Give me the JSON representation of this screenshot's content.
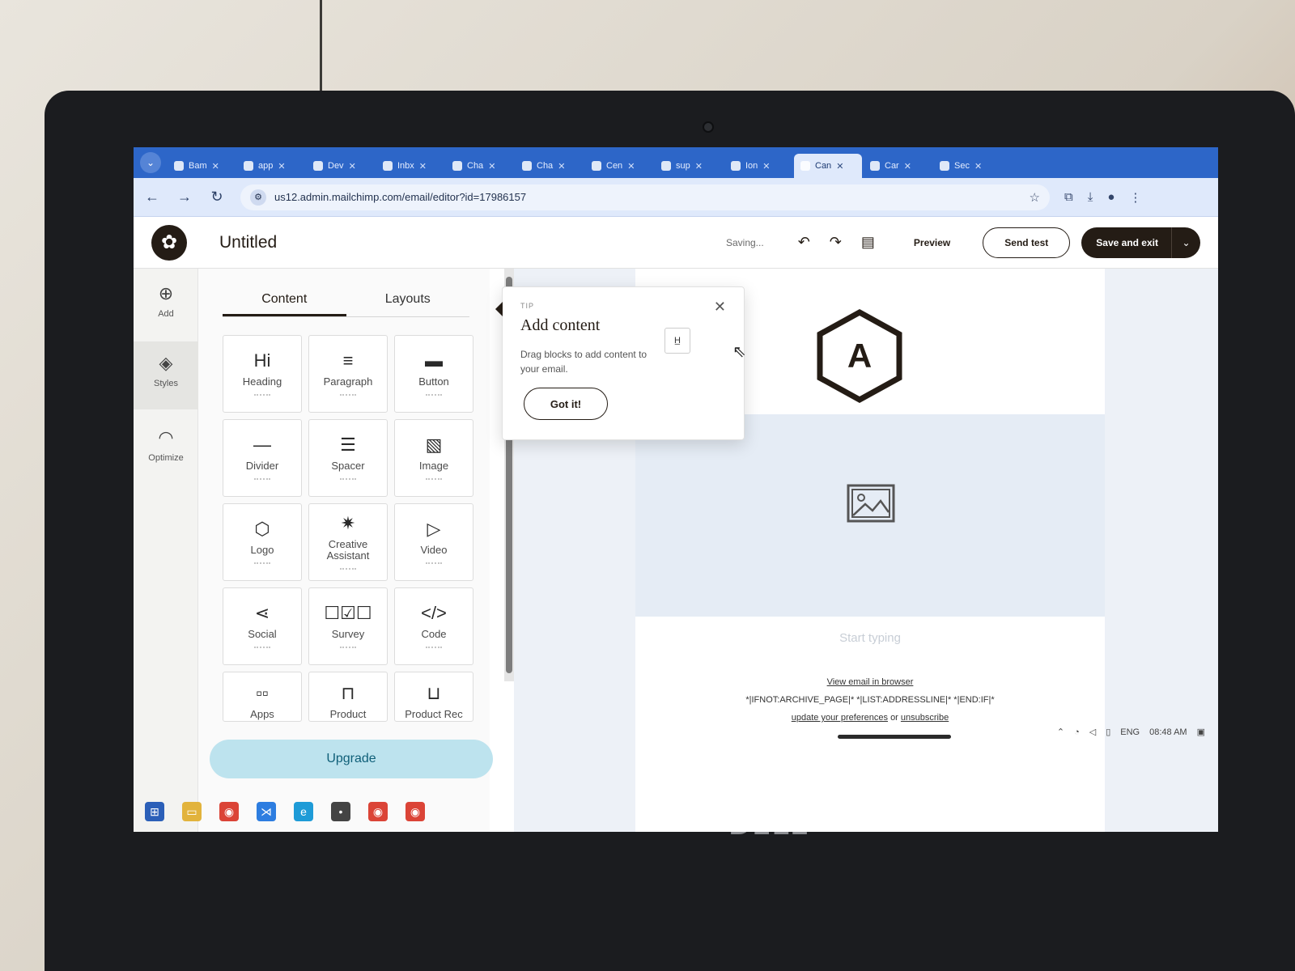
{
  "browser": {
    "tabs": [
      {
        "label": "Bam",
        "active": false
      },
      {
        "label": "app",
        "active": false
      },
      {
        "label": "Dev",
        "active": false
      },
      {
        "label": "Inbx",
        "active": false
      },
      {
        "label": "Cha",
        "active": false
      },
      {
        "label": "Cha",
        "active": false
      },
      {
        "label": "Cen",
        "active": false
      },
      {
        "label": "sup",
        "active": false
      },
      {
        "label": "Ion",
        "active": false
      },
      {
        "label": "Can",
        "active": true
      },
      {
        "label": "Car",
        "active": false
      },
      {
        "label": "Sec",
        "active": false
      }
    ],
    "url": "us12.admin.mailchimp.com/email/editor?id=17986157"
  },
  "header": {
    "title": "Untitled",
    "status": "Saving...",
    "preview_label": "Preview",
    "send_test_label": "Send test",
    "save_exit_label": "Save and exit"
  },
  "rail": {
    "add": "Add",
    "styles": "Styles",
    "optimize": "Optimize",
    "help": "?"
  },
  "panel": {
    "tabs": [
      "Content",
      "Layouts"
    ],
    "blocks": [
      {
        "label": "Heading",
        "icon": "Hi"
      },
      {
        "label": "Paragraph",
        "icon": "≡"
      },
      {
        "label": "Button",
        "icon": "▬"
      },
      {
        "label": "Divider",
        "icon": "―"
      },
      {
        "label": "Spacer",
        "icon": "☰"
      },
      {
        "label": "Image",
        "icon": "▧"
      },
      {
        "label": "Logo",
        "icon": "⬡"
      },
      {
        "label": "Creative Assistant",
        "icon": "✷"
      },
      {
        "label": "Video",
        "icon": "▷"
      },
      {
        "label": "Social",
        "icon": "⋖"
      },
      {
        "label": "Survey",
        "icon": "☐☑☐"
      },
      {
        "label": "Code",
        "icon": "</>"
      },
      {
        "label": "Apps",
        "icon": "▫▫"
      },
      {
        "label": "Product",
        "icon": "⊓"
      },
      {
        "label": "Product Rec",
        "icon": "⊔"
      }
    ],
    "upgrade_label": "Upgrade"
  },
  "tip": {
    "kicker": "TIP",
    "title": "Add content",
    "body": "Drag blocks to add content to your email.",
    "button": "Got it!"
  },
  "email": {
    "logo_letter": "A",
    "start_typing": "Start typing",
    "view_in_browser": "View email in browser",
    "merge_line": "*|IFNOT:ARCHIVE_PAGE|* *|LIST:ADDRESSLINE|* *|END:IF|*",
    "update_prefs": "update your preferences",
    "or": "or",
    "unsubscribe": "unsubscribe"
  },
  "tray": {
    "lang": "ENG",
    "time": "08:48 AM"
  },
  "device": {
    "brand": "DELL"
  },
  "colors": {
    "tabbar": "#2d66c8",
    "brand_dark": "#241c15",
    "upgrade_bg": "#bde3ee"
  }
}
